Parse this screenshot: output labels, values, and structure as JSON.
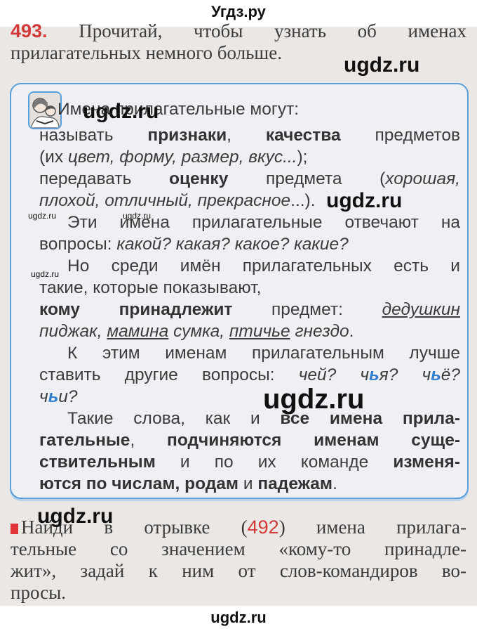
{
  "header": {
    "site": "Угдз.ру"
  },
  "footer": {
    "site": "ugdz.ru"
  },
  "colors": {
    "accent_blue": "#3b8fd8",
    "box_border": "#5a9fdc",
    "exercise_red": "#d23a3a",
    "page_bg": "#ebe7e5"
  },
  "icons": {
    "box_picture": "children-reading-icon",
    "bullet": "blue-triangle-bullet-icon",
    "task_marker": "red-square-icon"
  },
  "watermarks": [
    "ugdz.ru",
    "ugdz.ru",
    "ugdz.ru",
    "ugdz.ru",
    "ugdz.ru",
    "ugdz.ru",
    "ugdz.ru",
    "ugdz.ru"
  ],
  "exercise": {
    "number": "493.",
    "lines": [
      {
        "segs": [
          [
            "Прочитай, чтобы узнать об именах",
            ""
          ]
        ],
        "j": true
      },
      {
        "segs": [
          [
            "прилагательных немного больше.",
            ""
          ]
        ],
        "j": false
      }
    ]
  },
  "rule_box": {
    "heading": "Имена прилагательные могут:",
    "lines": [
      {
        "bul": true,
        "j": true,
        "segs": [
          [
            "называть ",
            ""
          ],
          [
            "признаки",
            "b"
          ],
          [
            ", ",
            ""
          ],
          [
            "качества",
            "b"
          ],
          [
            " предметов",
            ""
          ]
        ]
      },
      {
        "j": false,
        "segs": [
          [
            "(их ",
            ""
          ],
          [
            "цвет, форму, размер, вкус...",
            "i"
          ],
          [
            ");",
            ""
          ]
        ]
      },
      {
        "bul": true,
        "j": true,
        "segs": [
          [
            "передавать ",
            ""
          ],
          [
            "оценку",
            "b"
          ],
          [
            " предмета (",
            ""
          ],
          [
            "хорошая,",
            "i"
          ]
        ]
      },
      {
        "j": false,
        "segs": [
          [
            "плохой, отличный, прекрасное",
            "i"
          ],
          [
            "...).",
            ""
          ]
        ]
      },
      {
        "ind": true,
        "j": true,
        "segs": [
          [
            "Эти имена прилагательные отвечают на",
            ""
          ]
        ]
      },
      {
        "j": false,
        "segs": [
          [
            "вопросы: ",
            ""
          ],
          [
            "какой? какая? какое? какие?",
            "i"
          ]
        ]
      },
      {
        "ind": true,
        "j": true,
        "segs": [
          [
            "Но среди имён прилагательных есть и",
            ""
          ]
        ]
      },
      {
        "j": false,
        "segs": [
          [
            "такие, которые показывают,",
            ""
          ]
        ]
      },
      {
        "bul": true,
        "j": true,
        "segs": [
          [
            "кому принадлежит",
            "b"
          ],
          [
            " предмет: ",
            ""
          ],
          [
            "дедушкин",
            "u"
          ]
        ]
      },
      {
        "j": false,
        "segs": [
          [
            "пиджак, ",
            "i"
          ],
          [
            "мамина",
            "u"
          ],
          [
            " сумка, ",
            "i"
          ],
          [
            "птичье",
            "u"
          ],
          [
            " гнездо",
            "i"
          ],
          [
            ".",
            ""
          ]
        ]
      },
      {
        "ind": true,
        "j": true,
        "segs": [
          [
            "К этим именам прилагательным лучше",
            ""
          ]
        ]
      },
      {
        "j": true,
        "segs": [
          [
            "ставить другие вопросы: ",
            ""
          ],
          [
            "чей? ч",
            "i"
          ],
          [
            "ь",
            "bl"
          ],
          [
            "я? ч",
            "i"
          ],
          [
            "ь",
            "bl"
          ],
          [
            "ё?",
            "i"
          ]
        ]
      },
      {
        "j": false,
        "segs": [
          [
            "ч",
            "i"
          ],
          [
            "ь",
            "bl"
          ],
          [
            "и?",
            "i"
          ]
        ]
      },
      {
        "ind": true,
        "j": true,
        "segs": [
          [
            "Такие слова, как и ",
            ""
          ],
          [
            "все имена прила-",
            "b"
          ]
        ]
      },
      {
        "j": true,
        "segs": [
          [
            "гательные",
            "b"
          ],
          [
            ", ",
            ""
          ],
          [
            "подчиняются именам суще-",
            "b"
          ]
        ]
      },
      {
        "j": true,
        "segs": [
          [
            "ствительным",
            "b"
          ],
          [
            " и по их команде ",
            ""
          ],
          [
            "изменя-",
            "b"
          ]
        ]
      },
      {
        "j": false,
        "segs": [
          [
            "ются по числам, родам",
            "b"
          ],
          [
            " и ",
            ""
          ],
          [
            "падежам",
            "b"
          ],
          [
            ".",
            ""
          ]
        ]
      }
    ]
  },
  "task": {
    "lines": [
      {
        "j": true,
        "segs": [
          [
            "Найди в отрывке (",
            ""
          ],
          [
            "492",
            "red"
          ],
          [
            ") имена прилага-",
            ""
          ]
        ]
      },
      {
        "j": true,
        "segs": [
          [
            "тельные со значением «кому-то принадле-",
            ""
          ]
        ]
      },
      {
        "j": true,
        "segs": [
          [
            "жит», задай к ним от слов-командиров во-",
            ""
          ]
        ]
      },
      {
        "j": false,
        "segs": [
          [
            "просы.",
            ""
          ]
        ]
      }
    ]
  }
}
